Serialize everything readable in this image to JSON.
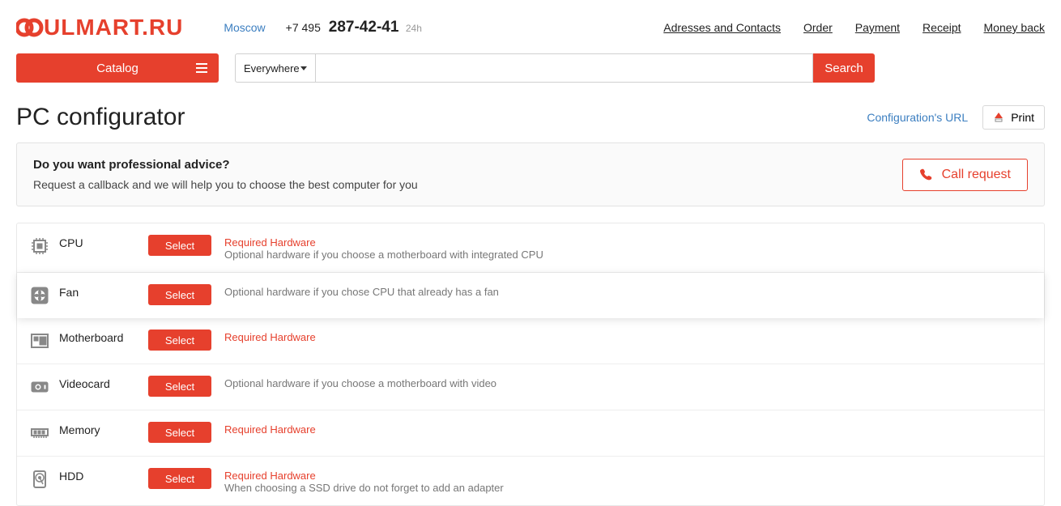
{
  "logo_text": "ULMART.RU",
  "city": "Moscow",
  "phone_prefix": "+7 495 ",
  "phone_main": "287-42-41",
  "phone_suffix": "24h",
  "toplinks": [
    "Adresses and Contacts",
    "Order",
    "Payment",
    "Receipt",
    "Money back"
  ],
  "catalog_label": "Catalog",
  "search_scope": "Everywhere",
  "search_btn": "Search",
  "page_title": "PC configurator",
  "config_url": "Configuration's URL",
  "print_label": "Print",
  "advice": {
    "title": "Do you want professional advice?",
    "desc": "Request a callback and we will help you to choose the best computer for you",
    "call_btn": "Call request"
  },
  "select_label": "Select",
  "hardware": [
    {
      "name": "CPU",
      "required": "Required Hardware",
      "optional": "Optional hardware if you choose a motherboard with integrated CPU",
      "highlighted": false,
      "icon": "cpu"
    },
    {
      "name": "Fan",
      "required": "",
      "optional": "Optional hardware if you chose CPU that already has a fan",
      "highlighted": true,
      "icon": "fan"
    },
    {
      "name": "Motherboard",
      "required": "Required Hardware",
      "optional": "",
      "highlighted": false,
      "icon": "motherboard"
    },
    {
      "name": "Videocard",
      "required": "",
      "optional": "Optional hardware if you choose a motherboard with video",
      "highlighted": false,
      "icon": "videocard"
    },
    {
      "name": "Memory",
      "required": "Required Hardware",
      "optional": "",
      "highlighted": false,
      "icon": "memory"
    },
    {
      "name": "HDD",
      "required": "Required Hardware",
      "optional": "When choosing a SSD drive do not forget to add an adapter",
      "highlighted": false,
      "icon": "hdd"
    }
  ]
}
